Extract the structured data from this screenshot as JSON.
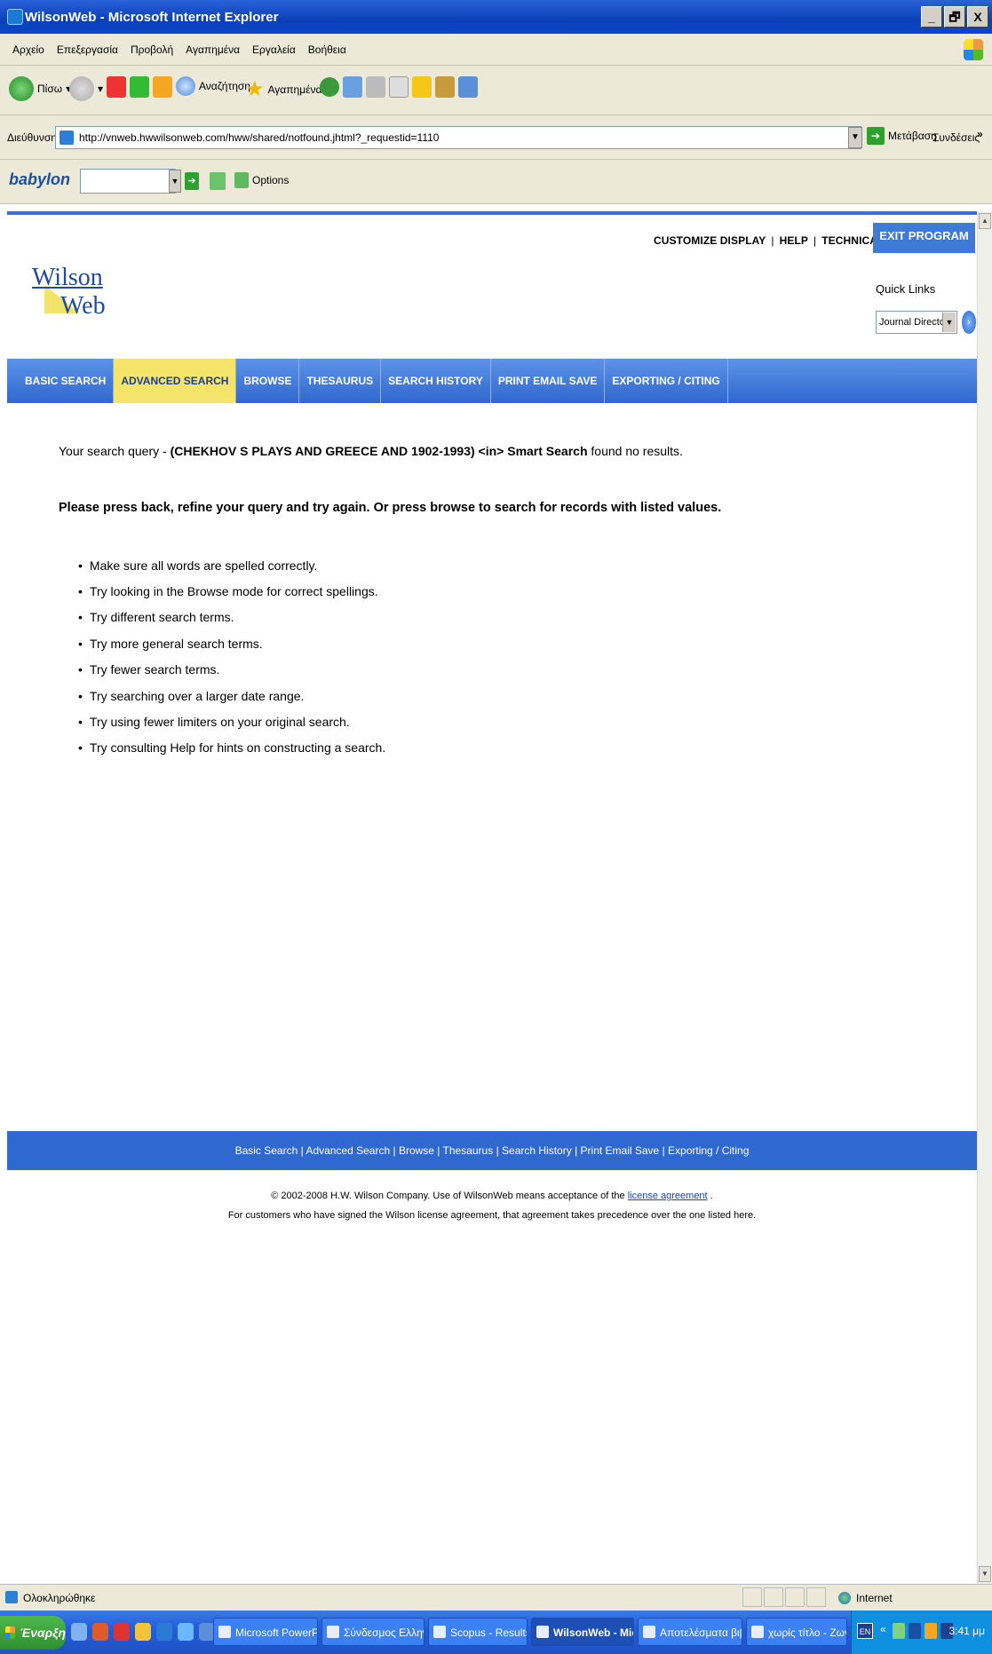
{
  "window": {
    "title": "WilsonWeb - Microsoft Internet Explorer",
    "buttons": [
      "_",
      "🗗",
      "X"
    ]
  },
  "menu": [
    "Αρχείο",
    "Επεξεργασία",
    "Προβολή",
    "Αγαπημένα",
    "Εργαλεία",
    "Βοήθεια"
  ],
  "toolbar": {
    "back": "Πίσω",
    "search": "Αναζήτηση",
    "favorites": "Αγαπημένα"
  },
  "address": {
    "label": "Διεύθυνση",
    "url": "http://vnweb.hwwilsonweb.com/hww/shared/notfound.jhtml?_requestid=1110",
    "go": "Μετάβαση",
    "links": "Συνδέσεις",
    "more": "»"
  },
  "babylon": {
    "logo": "babylon",
    "options": "Options"
  },
  "page": {
    "utility_links": [
      "CUSTOMIZE DISPLAY",
      "HELP",
      "TECHNICAL SUPPORT"
    ],
    "exit": "EXIT PROGRAM",
    "logo_line1": "Wilson",
    "logo_line2": "Web",
    "quick_links_label": "Quick Links",
    "quick_links_value": "Journal Directory",
    "nav": [
      "BASIC SEARCH",
      "ADVANCED SEARCH",
      "BROWSE",
      "THESAURUS",
      "SEARCH HISTORY",
      "PRINT EMAIL SAVE",
      "EXPORTING / CITING"
    ],
    "active_nav_index": 1,
    "query_prefix": "Your search query - ",
    "query": "(CHEKHOV S PLAYS AND GREECE AND 1902-1993) <in> Smart Search",
    "query_suffix": " found no results.",
    "advice": "Please press back, refine your query and try again. Or press browse to search for records with listed values.",
    "tips": [
      "Make sure all words are spelled correctly.",
      "Try looking in the Browse mode for correct spellings.",
      "Try different search terms.",
      "Try more general search terms.",
      "Try fewer search terms.",
      "Try searching over a larger date range.",
      "Try using fewer limiters on your original search.",
      "Try consulting Help for hints on constructing a search."
    ],
    "footer_links": [
      "Basic Search",
      "Advanced Search",
      "Browse",
      "Thesaurus",
      "Search History",
      "Print Email Save",
      "Exporting / Citing"
    ],
    "copyright_pre": "© 2002-2008 H.W. Wilson Company. Use of WilsonWeb means acceptance of the ",
    "license_link": "license agreement",
    "copyright_post": " .",
    "copyright_line2": "For customers who have signed the Wilson license agreement, that agreement takes precedence over the one listed here."
  },
  "status": {
    "message": "Ολοκληρώθηκε",
    "zone": "Internet"
  },
  "taskbar": {
    "start": "Έναρξη",
    "tasks": [
      "Microsoft PowerPoi...",
      "Σύνδεσμος Ελληνι...",
      "Scopus - Results P...",
      "WilsonWeb - Mic...",
      "Αποτελέσματα βιβλ...",
      "χωρίς τίτλο - Ζωγρ..."
    ],
    "active_task_index": 3,
    "lang": "EN",
    "chevron": "«",
    "time": "3:41 μμ"
  },
  "colors": {
    "nav_blue": "#2f68cf",
    "active_tab": "#f5e46a",
    "title_blue": "#0a3fb8"
  }
}
